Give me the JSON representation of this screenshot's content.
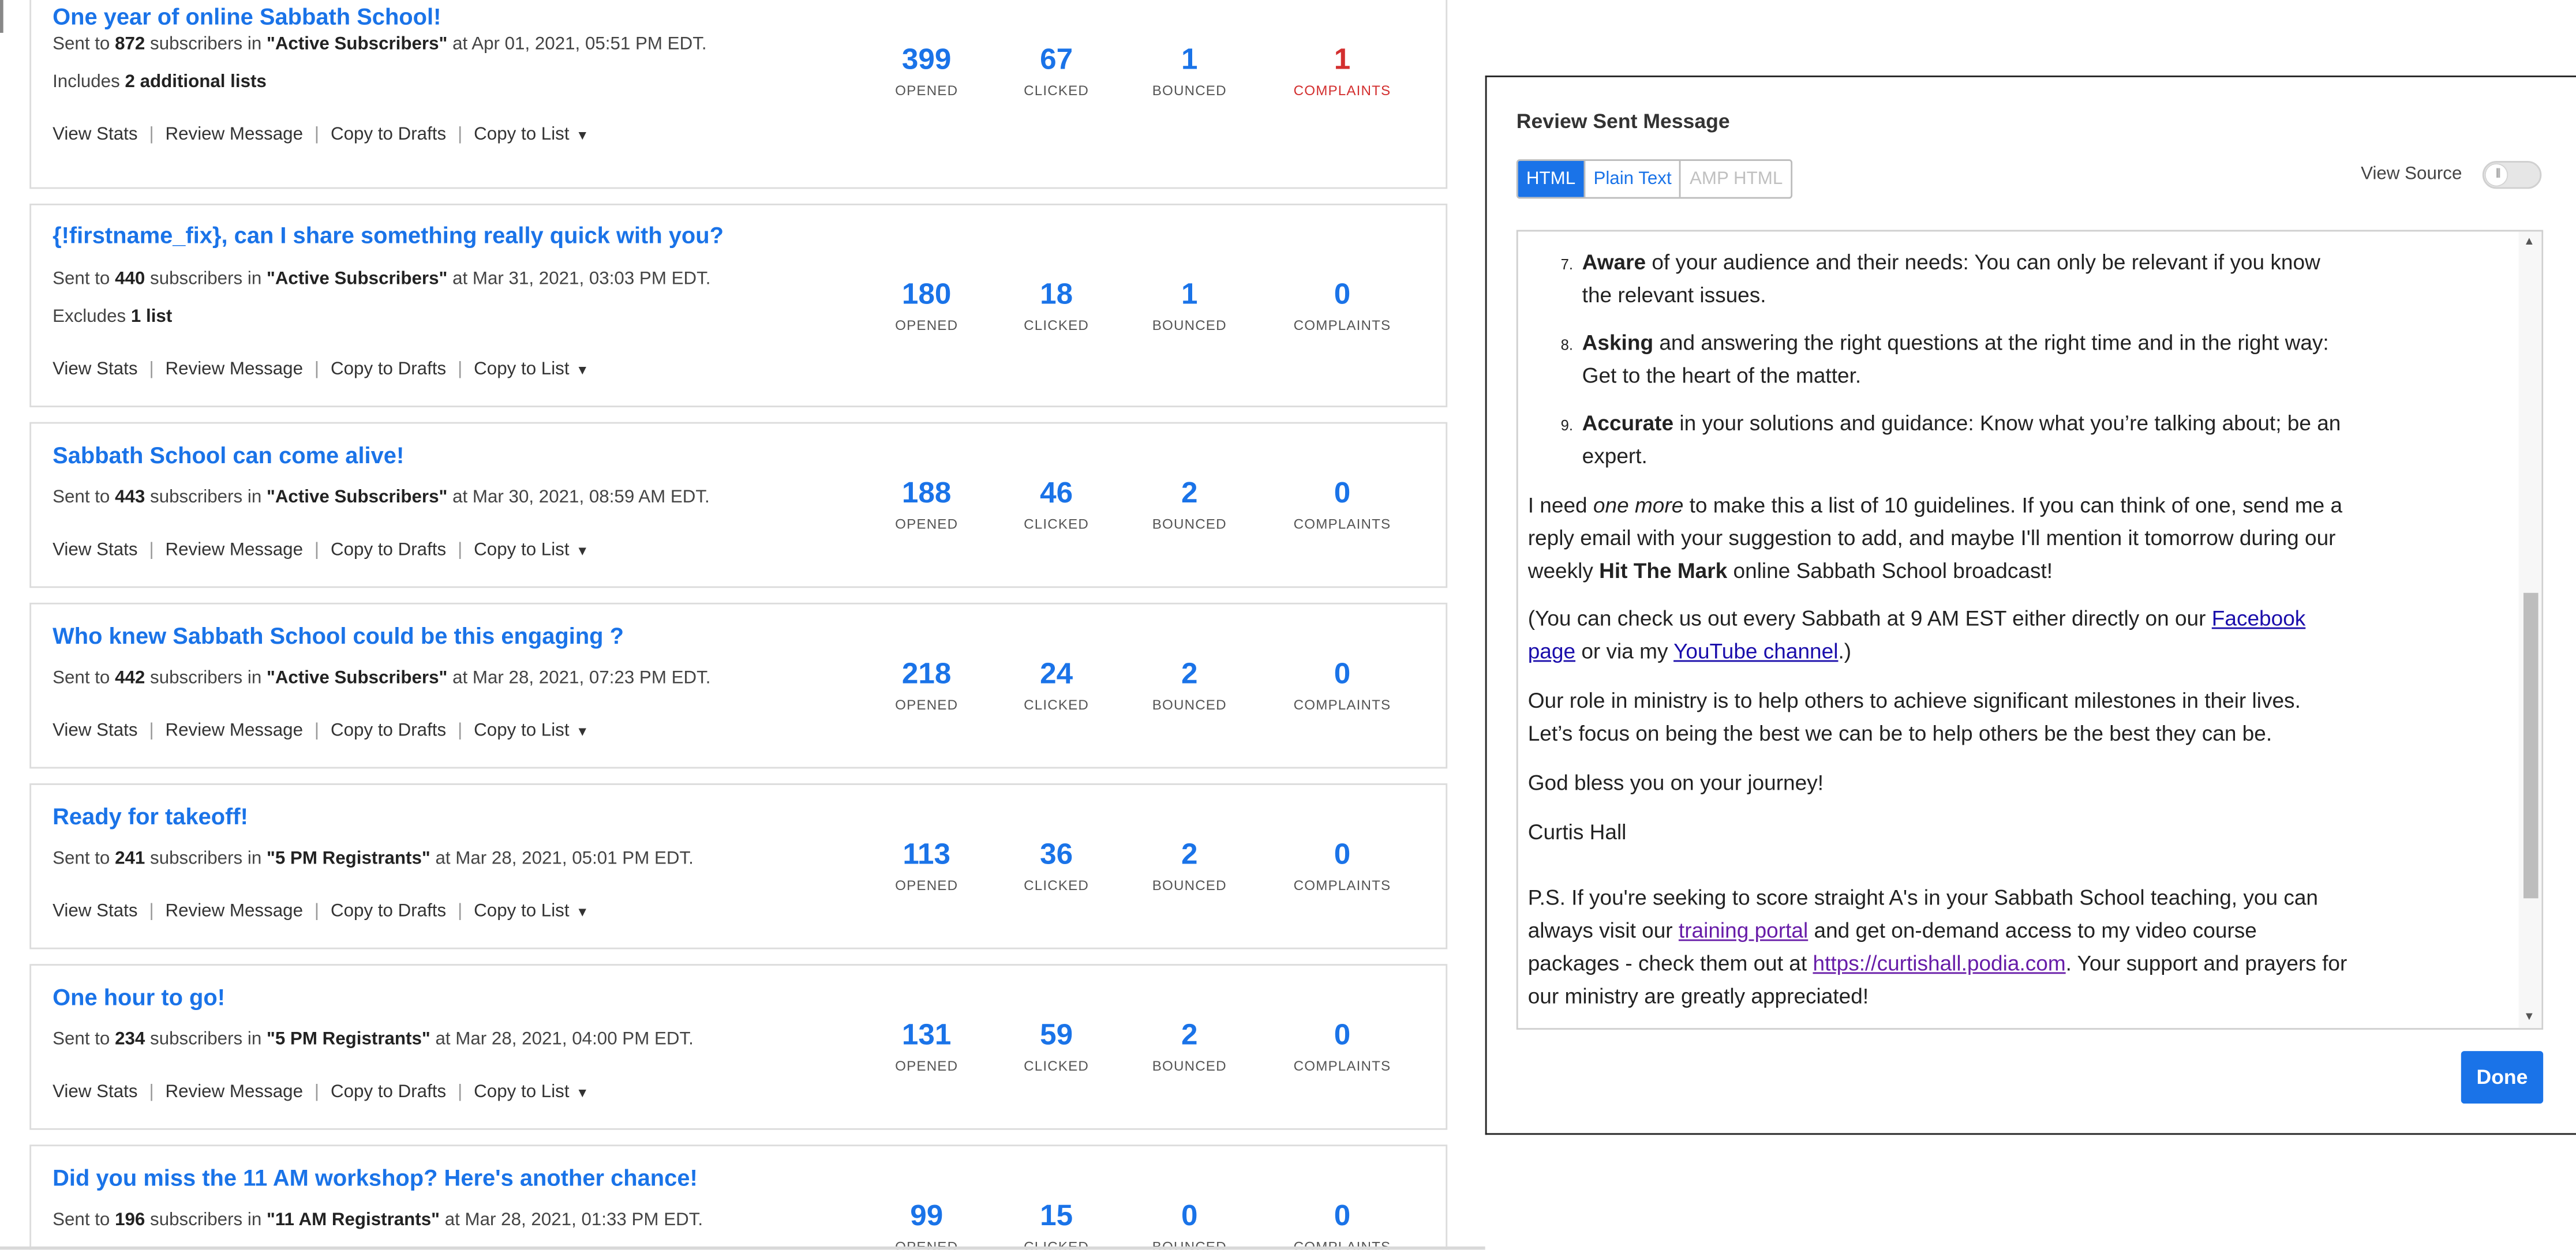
{
  "messages": [
    {
      "title": "One year of online Sabbath School!",
      "sent_prefix": "Sent to ",
      "count": "872",
      "mid": " subscribers in ",
      "list": "\"Active Subscribers\"",
      "date": " at Apr 01, 2021, 05:51 PM EDT.",
      "extra_prefix": "Includes ",
      "extra_bold": "2 additional lists",
      "opened": "399",
      "clicked": "67",
      "bounced": "1",
      "complaints": "1"
    },
    {
      "title": "{!firstname_fix}, can I share something really quick with you?",
      "sent_prefix": "Sent to ",
      "count": "440",
      "mid": " subscribers in ",
      "list": "\"Active Subscribers\"",
      "date": " at Mar 31, 2021, 03:03 PM EDT.",
      "extra_prefix": "Excludes ",
      "extra_bold": "1 list",
      "opened": "180",
      "clicked": "18",
      "bounced": "1",
      "complaints": "0"
    },
    {
      "title": "Sabbath School can come alive!",
      "sent_prefix": "Sent to ",
      "count": "443",
      "mid": " subscribers in ",
      "list": "\"Active Subscribers\"",
      "date": " at Mar 30, 2021, 08:59 AM EDT.",
      "opened": "188",
      "clicked": "46",
      "bounced": "2",
      "complaints": "0"
    },
    {
      "title": "Who knew Sabbath School could be this engaging ?",
      "sent_prefix": "Sent to ",
      "count": "442",
      "mid": " subscribers in ",
      "list": "\"Active Subscribers\"",
      "date": " at Mar 28, 2021, 07:23 PM EDT.",
      "opened": "218",
      "clicked": "24",
      "bounced": "2",
      "complaints": "0"
    },
    {
      "title": "Ready for takeoff!",
      "sent_prefix": "Sent to ",
      "count": "241",
      "mid": " subscribers in ",
      "list": "\"5 PM Registrants\"",
      "date": " at Mar 28, 2021, 05:01 PM EDT.",
      "opened": "113",
      "clicked": "36",
      "bounced": "2",
      "complaints": "0"
    },
    {
      "title": "One hour to go!",
      "sent_prefix": "Sent to ",
      "count": "234",
      "mid": " subscribers in ",
      "list": "\"5 PM Registrants\"",
      "date": " at Mar 28, 2021, 04:00 PM EDT.",
      "opened": "131",
      "clicked": "59",
      "bounced": "2",
      "complaints": "0"
    },
    {
      "title": "Did you miss the 11 AM workshop? Here's another chance!",
      "sent_prefix": "Sent to ",
      "count": "196",
      "mid": " subscribers in ",
      "list": "\"11 AM Registrants\"",
      "date": " at Mar 28, 2021, 01:33 PM EDT.",
      "opened": "99",
      "clicked": "15",
      "bounced": "0",
      "complaints": "0"
    }
  ],
  "actions": {
    "view_stats": "View Stats",
    "review_message": "Review Message",
    "copy_to_drafts": "Copy to Drafts",
    "copy_to_list": "Copy to List",
    "sep": "|"
  },
  "stat_labels": {
    "opened": "OPENED",
    "clicked": "CLICKED",
    "bounced": "BOUNCED",
    "complaints": "COMPLAINTS"
  },
  "colors": {
    "accent": "#1a73e8",
    "complaint_red": "#d32f2f"
  },
  "modal": {
    "title": "Review Sent Message",
    "tabs": [
      "HTML",
      "Plain Text",
      "AMP HTML"
    ],
    "active_tab": "HTML",
    "view_source_label": "View Source",
    "view_source_on": false,
    "done_label": "Done",
    "email": {
      "items": [
        {
          "num": "7.",
          "bold": "Aware",
          "text": " of your audience and their needs: You can only be relevant if you know the relevant issues."
        },
        {
          "num": "8.",
          "bold": "Asking",
          "text": " and answering the right questions at the right time and in the right way: Get to the heart of the matter."
        },
        {
          "num": "9.",
          "bold": "Accurate",
          "text": " in your solutions and guidance: Know what you’re talking about; be an expert."
        }
      ],
      "p1_a": "I need ",
      "p1_em": "one more",
      "p1_b": " to make this a list of 10 guidelines. If you can think of one, send me a reply email with your suggestion to add, and maybe I'll mention it tomorrow during our weekly ",
      "p1_bold": "Hit The Mark",
      "p1_c": " online Sabbath School broadcast!",
      "p2_a": "(You can check us out every Sabbath at 9 AM EST either directly on our ",
      "p2_link1": "Facebook page",
      "p2_b": " or via my ",
      "p2_link2": "YouTube channel",
      "p2_c": ".)",
      "p3": "Our role in ministry is to help others to achieve significant milestones in their lives. Let’s focus on being the best we can be to help others be the best they can be.",
      "p4": "God bless you on your journey!",
      "p5": "Curtis Hall",
      "p6_a": "P.S. If you're seeking to score straight A's in your Sabbath School teaching, you can always visit our ",
      "p6_link1": "training portal",
      "p6_b": " and get on-demand access to my video course packages - check them out at ",
      "p6_link2": "https://curtishall.podia.com",
      "p6_c": ". Your support and prayers for our ministry are greatly appreciated!"
    }
  }
}
